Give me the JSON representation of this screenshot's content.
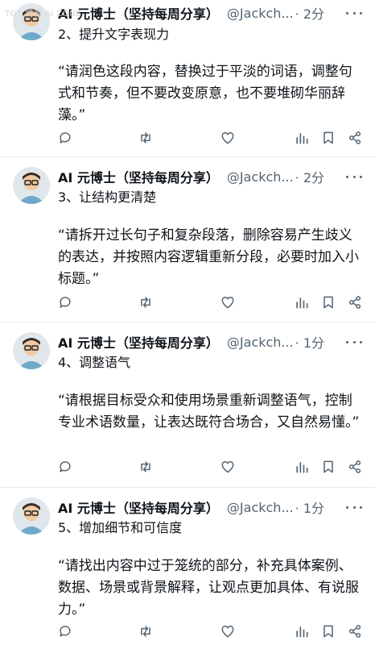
{
  "watermark": "TG：博客 AI ZONE",
  "tweets": [
    {
      "author": "AI 元博士（坚持每周分享）",
      "handle": "@Jackch...",
      "time": "· 2分",
      "heading": "2、提升文字表现力",
      "quote": "“请润色这段内容，替换过于平淡的词语，调整句式和节奏，但不要改变原意，也不要堆砌华丽辞藻。”"
    },
    {
      "author": "AI 元博士（坚持每周分享）",
      "handle": "@Jackch...",
      "time": "· 2分",
      "heading": "3、让结构更清楚",
      "quote": "“请拆开过长句子和复杂段落，删除容易产生歧义的表达，并按照内容逻辑重新分段，必要时加入小标题。”"
    },
    {
      "author": "AI 元博士（坚持每周分享）",
      "handle": "@Jackch...",
      "time": "· 1分",
      "heading": "4、调整语气",
      "quote": "“请根据目标受众和使用场景重新调整语气，控制专业术语数量，让表达既符合场合，又自然易懂。”"
    },
    {
      "author": "AI 元博士（坚持每周分享）",
      "handle": "@Jackch...",
      "time": "· 1分",
      "heading": "5、增加细节和可信度",
      "quote": "“请找出内容中过于笼统的部分，补充具体案例、数据、场景或背景解释，让观点更加具体、有说服力。”"
    }
  ],
  "icons": [
    "more-icon",
    "reply-icon",
    "retweet-icon",
    "like-icon",
    "views-icon",
    "bookmark-icon",
    "share-icon"
  ],
  "colors": {
    "text": "#0f1419",
    "muted": "#536471",
    "divider": "#e6e9eb"
  }
}
